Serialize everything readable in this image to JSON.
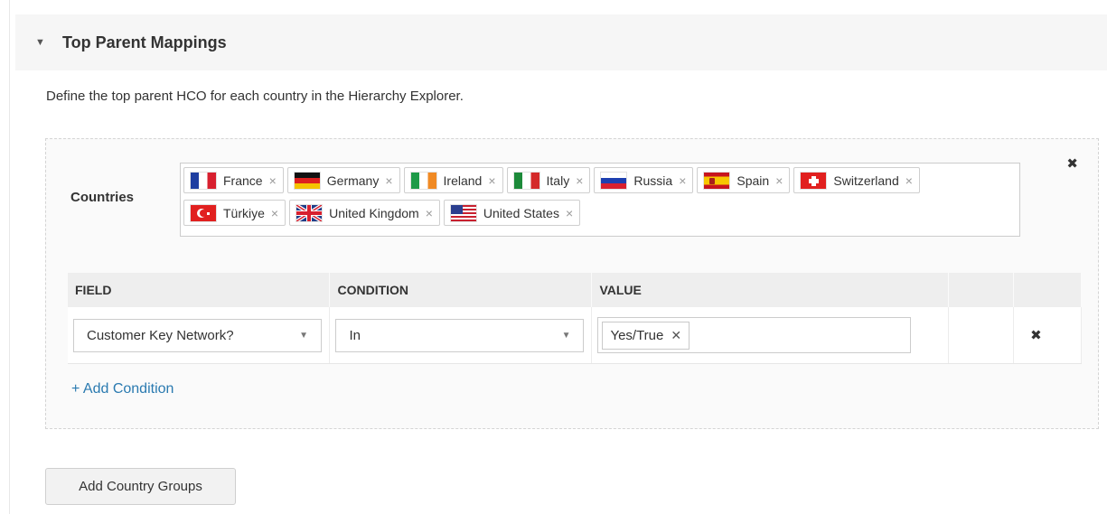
{
  "section": {
    "title": "Top Parent Mappings",
    "collapse_icon": "triangle-down-icon"
  },
  "description": "Define the top parent HCO for each country in the Hierarchy Explorer.",
  "group": {
    "remove_label": "✖",
    "countries_label": "Countries",
    "countries": [
      {
        "label": "France",
        "flag": "flag-france-icon"
      },
      {
        "label": "Germany",
        "flag": "flag-germany-icon"
      },
      {
        "label": "Ireland",
        "flag": "flag-ireland-icon"
      },
      {
        "label": "Italy",
        "flag": "flag-italy-icon"
      },
      {
        "label": "Russia",
        "flag": "flag-russia-icon"
      },
      {
        "label": "Spain",
        "flag": "flag-spain-icon"
      },
      {
        "label": "Switzerland",
        "flag": "flag-switzerland-icon"
      },
      {
        "label": "Türkiye",
        "flag": "flag-turkiye-icon"
      },
      {
        "label": "United Kingdom",
        "flag": "flag-united-kingdom-icon"
      },
      {
        "label": "United States",
        "flag": "flag-united-states-icon"
      }
    ],
    "chip_remove_label": "×",
    "table": {
      "headers": [
        "FIELD",
        "CONDITION",
        "VALUE"
      ],
      "rows": [
        {
          "field": "Customer Key Network?",
          "condition": "In",
          "values": [
            "Yes/True"
          ],
          "remove_label": "✖"
        }
      ]
    },
    "add_condition_label": "+ Add Condition"
  },
  "add_country_groups_label": "Add Country Groups",
  "colors": {
    "link": "#2a7ab0",
    "header_bg": "#f6f6f6",
    "table_header_bg": "#eeeeee"
  }
}
